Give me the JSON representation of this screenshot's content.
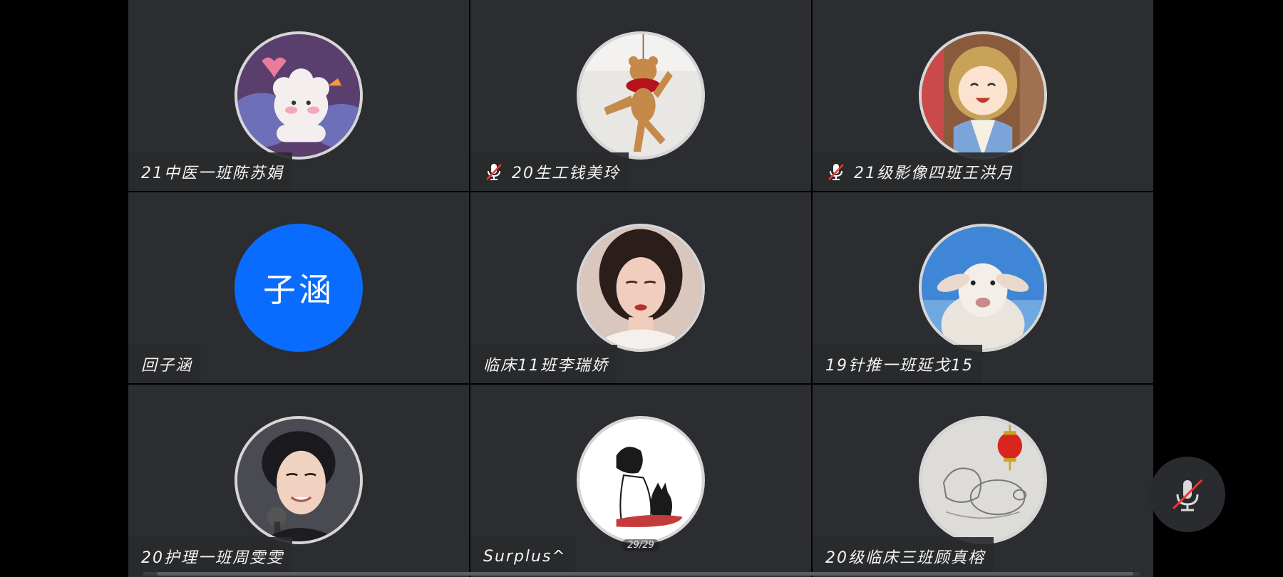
{
  "participants": [
    {
      "name": "21中医一班陈苏娟",
      "muted": false,
      "avatar": "cartoon-sheep-avatar"
    },
    {
      "name": "20生工钱美玲",
      "muted": true,
      "avatar": "toy-bear-avatar"
    },
    {
      "name": "21级影像四班王洪月",
      "muted": true,
      "avatar": "anime-girl-avatar"
    },
    {
      "name": "回子涵",
      "muted": false,
      "avatar": "initials-avatar",
      "initials": "子涵",
      "avatar_color": "#0A6CFF"
    },
    {
      "name": "临床11班李瑞娇",
      "muted": false,
      "avatar": "portrait-girl-avatar"
    },
    {
      "name": "19针推一班延戈15",
      "muted": false,
      "avatar": "lamb-photo-avatar"
    },
    {
      "name": "20护理一班周雯雯",
      "muted": false,
      "avatar": "young-man-portrait-avatar"
    },
    {
      "name": "Surplus^",
      "muted": false,
      "avatar": "girl-with-cat-sketch-avatar"
    },
    {
      "name": "20级临床三班顾真榕",
      "muted": false,
      "avatar": "pig-sketch-lantern-avatar"
    }
  ],
  "page_indicator": "29/29",
  "controls": {
    "mic_button": "mic-off-icon"
  },
  "colors": {
    "tile_bg": "#2B2D30",
    "initials_avatar": "#0A6CFF",
    "mute_slash": "#E53935"
  }
}
